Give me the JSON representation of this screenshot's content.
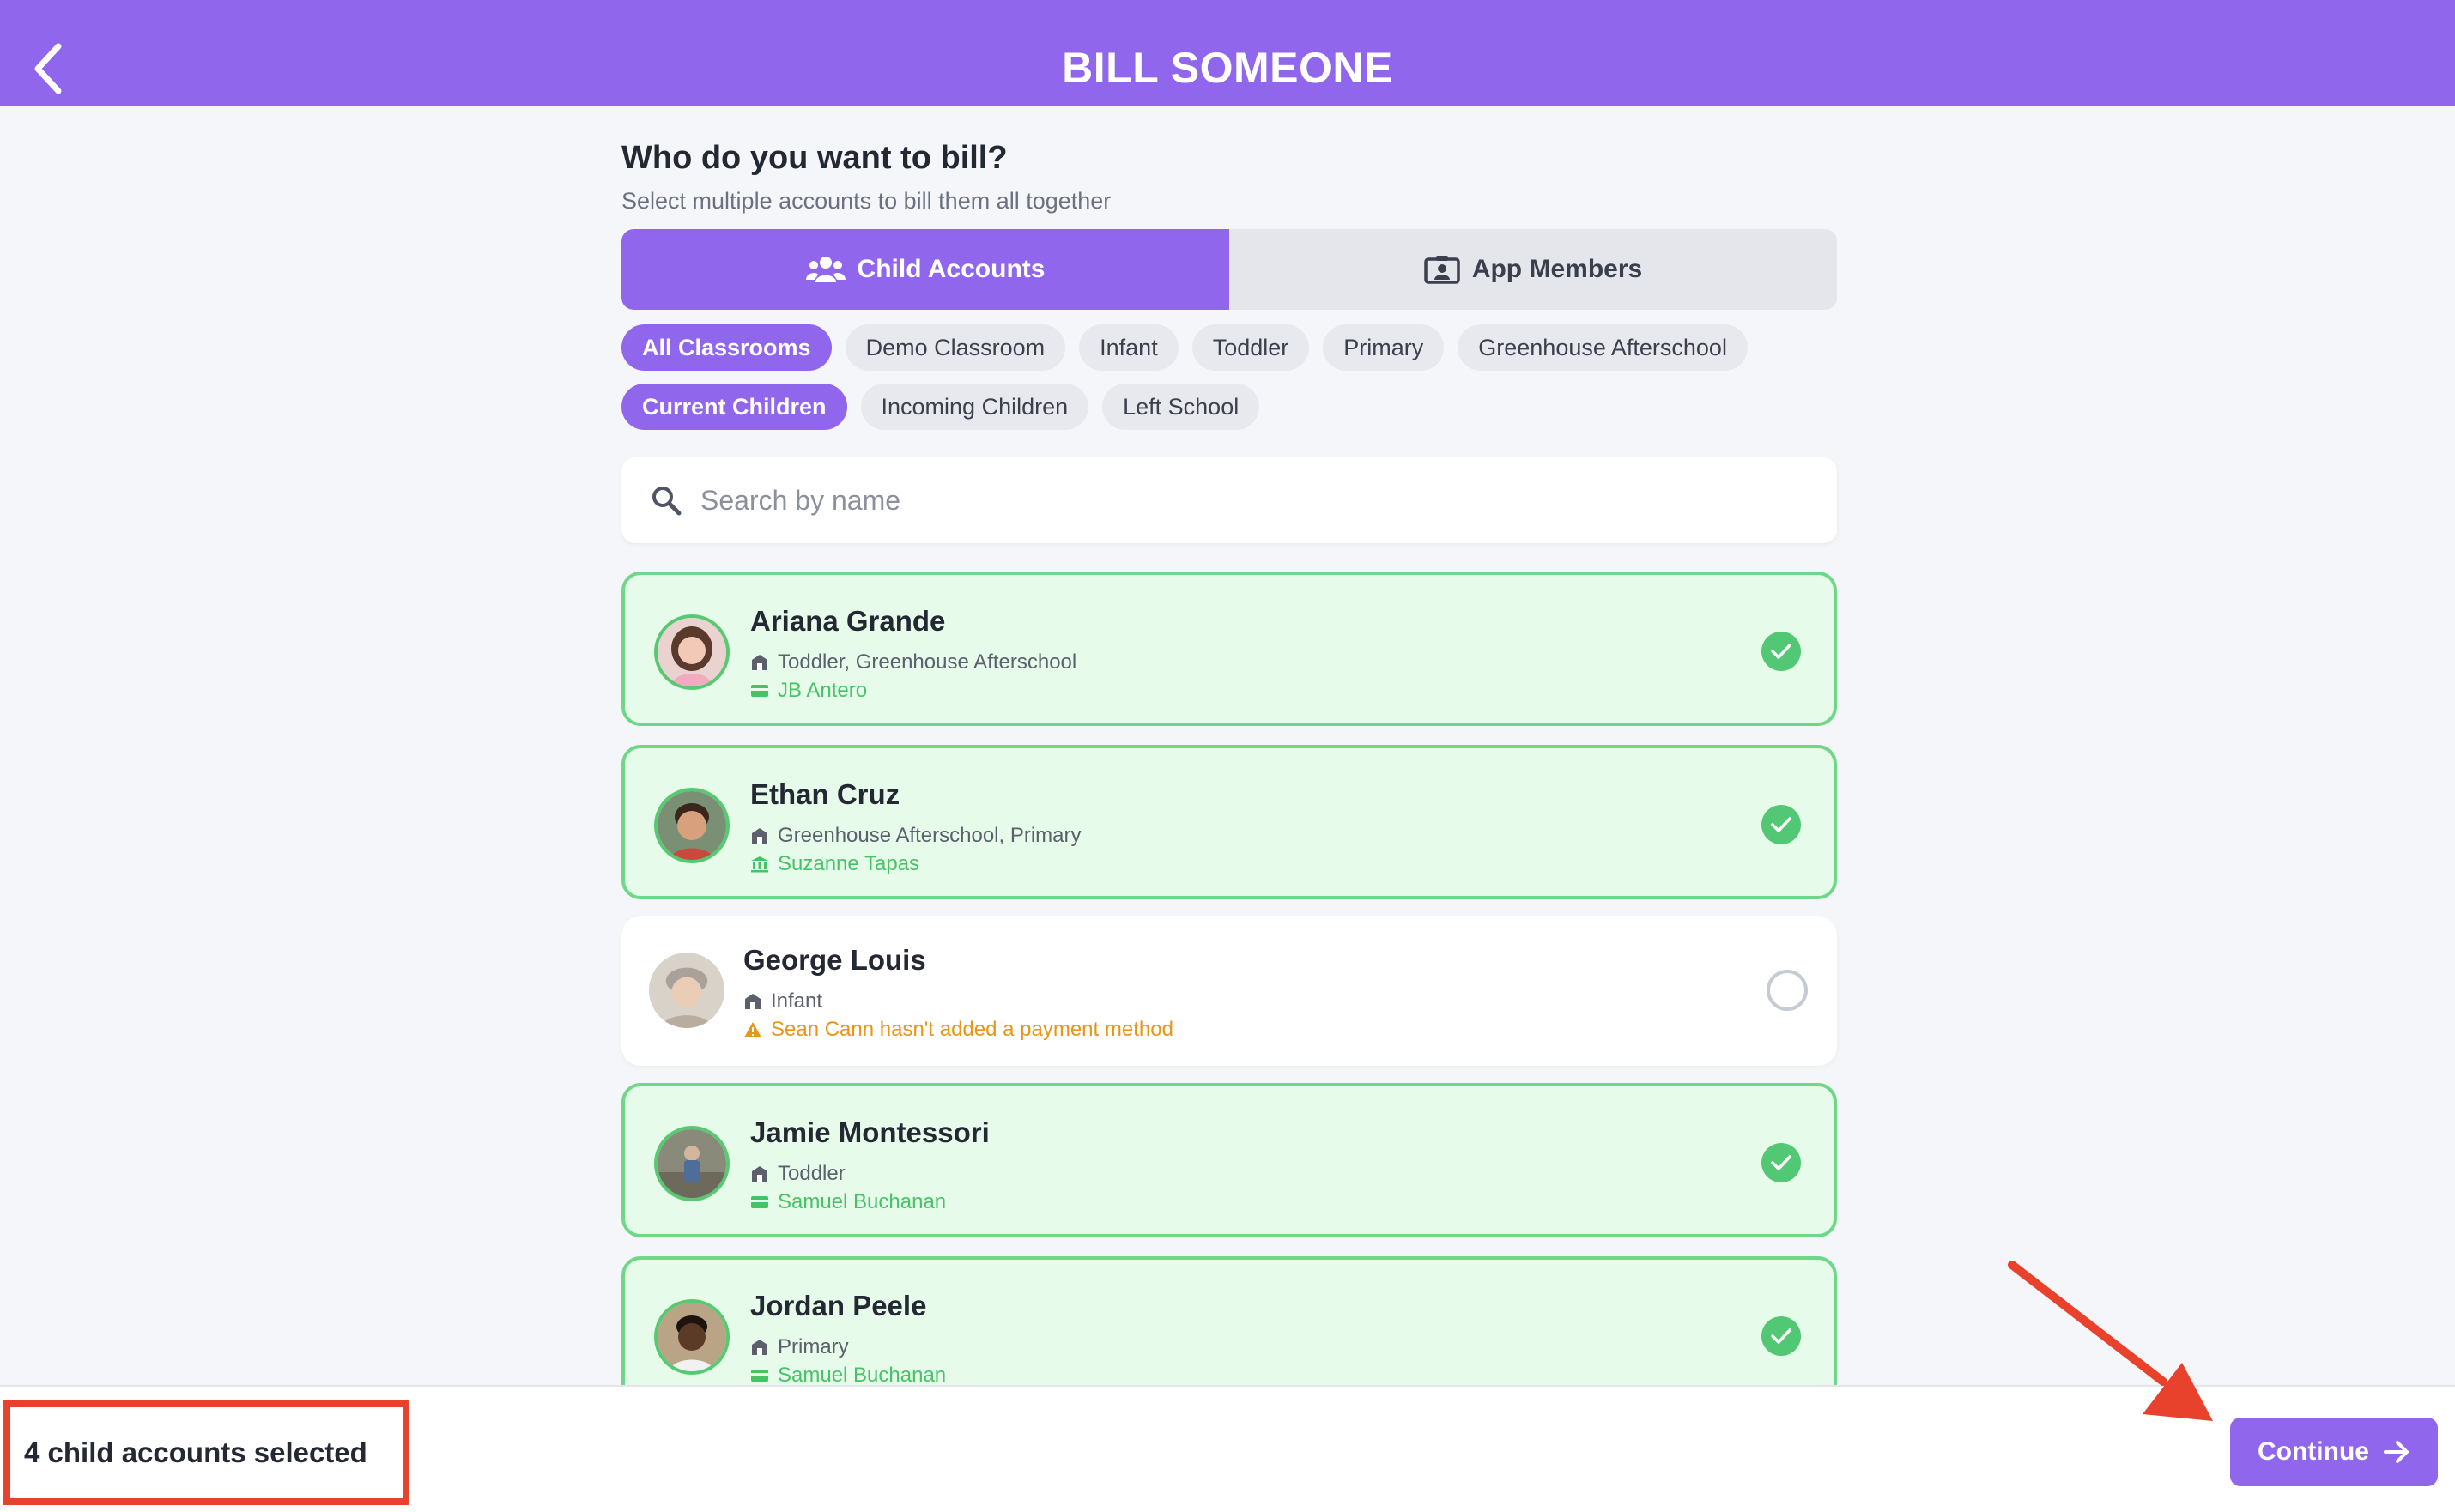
{
  "header": {
    "title": "BILL SOMEONE",
    "back_icon": "chevron-left-icon"
  },
  "prompt": {
    "title": "Who do you want to bill?",
    "subtitle": "Select multiple accounts to bill them all together"
  },
  "tabs": [
    {
      "label": "Child Accounts",
      "icon": "users-icon",
      "active": true
    },
    {
      "label": "App Members",
      "icon": "id-card-icon",
      "active": false
    }
  ],
  "classroom_filters": [
    {
      "label": "All Classrooms",
      "active": true
    },
    {
      "label": "Demo Classroom",
      "active": false
    },
    {
      "label": "Infant",
      "active": false
    },
    {
      "label": "Toddler",
      "active": false
    },
    {
      "label": "Primary",
      "active": false
    },
    {
      "label": "Greenhouse Afterschool",
      "active": false
    }
  ],
  "status_filters": [
    {
      "label": "Current Children",
      "active": true
    },
    {
      "label": "Incoming Children",
      "active": false
    },
    {
      "label": "Left School",
      "active": false
    }
  ],
  "search": {
    "placeholder": "Search by name",
    "value": ""
  },
  "children": [
    {
      "name": "Ariana Grande",
      "classrooms": "Toddler, Greenhouse Afterschool",
      "payer": "JB Antero",
      "payer_icon": "card-icon",
      "selected": true,
      "warning": false
    },
    {
      "name": "Ethan Cruz",
      "classrooms": "Greenhouse Afterschool, Primary",
      "payer": "Suzanne Tapas",
      "payer_icon": "bank-icon",
      "selected": true,
      "warning": false
    },
    {
      "name": "George Louis",
      "classrooms": "Infant",
      "payer": "Sean Cann hasn't added a payment method",
      "payer_icon": "warning-icon",
      "selected": false,
      "warning": true
    },
    {
      "name": "Jamie Montessori",
      "classrooms": "Toddler",
      "payer": "Samuel Buchanan",
      "payer_icon": "card-icon",
      "selected": true,
      "warning": false
    },
    {
      "name": "Jordan Peele",
      "classrooms": "Primary",
      "payer": "Samuel Buchanan",
      "payer_icon": "card-icon",
      "selected": true,
      "warning": false
    }
  ],
  "footer": {
    "selected_text": "4 child accounts selected",
    "continue_label": "Continue"
  },
  "colors": {
    "brand": "#9066ec",
    "selected_bg": "#e6fbea",
    "selected_border": "#6fd888",
    "check": "#52c874",
    "warning": "#e99518",
    "annotation": "#e8412c"
  }
}
